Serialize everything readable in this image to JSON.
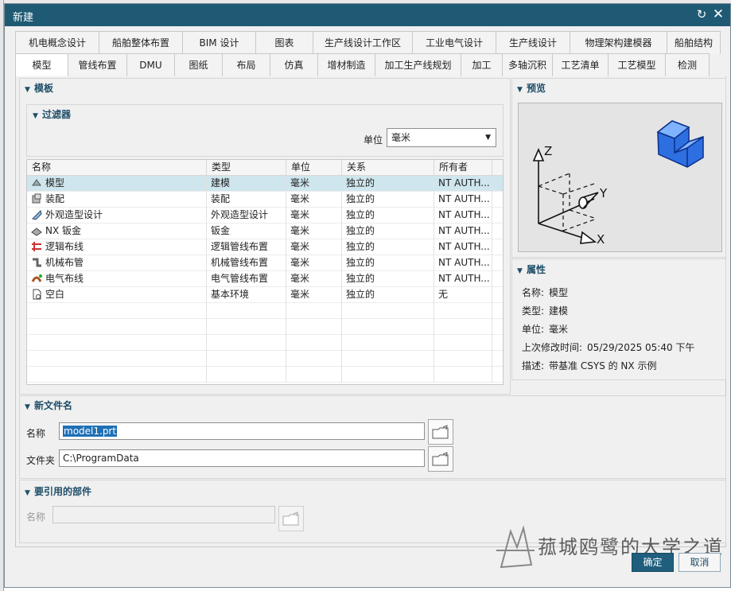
{
  "dialog": {
    "title": "新建",
    "reset_icon": "refresh-icon",
    "close_icon": "close-icon"
  },
  "tabs_row1": [
    "机电概念设计",
    "船舶整体布置",
    "BIM 设计",
    "图表",
    "生产线设计工作区",
    "工业电气设计",
    "生产线设计",
    "物理架构建模器",
    "船舶结构"
  ],
  "tabs_row2": [
    "模型",
    "管线布置",
    "DMU",
    "图纸",
    "布局",
    "仿真",
    "增材制造",
    "加工生产线规划",
    "加工",
    "多轴沉积",
    "工艺清单",
    "工艺模型",
    "检测"
  ],
  "active_tab": "模型",
  "templates": {
    "header": "模板",
    "filter": {
      "header": "过滤器",
      "unit_label": "单位",
      "unit_value": "毫米"
    },
    "columns": [
      "名称",
      "类型",
      "单位",
      "关系",
      "所有者"
    ],
    "rows": [
      {
        "name": "模型",
        "type": "建模",
        "unit": "毫米",
        "relation": "独立的",
        "owner": "NT AUTH...",
        "icon": "model-icon"
      },
      {
        "name": "装配",
        "type": "装配",
        "unit": "毫米",
        "relation": "独立的",
        "owner": "NT AUTH...",
        "icon": "assembly-icon"
      },
      {
        "name": "外观造型设计",
        "type": "外观造型设计",
        "unit": "毫米",
        "relation": "独立的",
        "owner": "NT AUTH...",
        "icon": "shape-studio-icon"
      },
      {
        "name": "NX 钣金",
        "type": "钣金",
        "unit": "毫米",
        "relation": "独立的",
        "owner": "NT AUTH...",
        "icon": "sheet-metal-icon"
      },
      {
        "name": "逻辑布线",
        "type": "逻辑管线布置",
        "unit": "毫米",
        "relation": "独立的",
        "owner": "NT AUTH...",
        "icon": "logical-routing-icon"
      },
      {
        "name": "机械布管",
        "type": "机械管线布置",
        "unit": "毫米",
        "relation": "独立的",
        "owner": "NT AUTH...",
        "icon": "mechanical-routing-icon"
      },
      {
        "name": "电气布线",
        "type": "电气管线布置",
        "unit": "毫米",
        "relation": "独立的",
        "owner": "NT AUTH...",
        "icon": "electrical-routing-icon"
      },
      {
        "name": "空白",
        "type": "基本环境",
        "unit": "毫米",
        "relation": "独立的",
        "owner": "无",
        "icon": "blank-file-icon"
      }
    ],
    "selected_row": 0
  },
  "preview": {
    "header": "预览",
    "axis_labels": {
      "z": "Z",
      "y": "Y",
      "x": "X"
    }
  },
  "properties": {
    "header": "属性",
    "rows": [
      {
        "label": "名称:",
        "value": "模型"
      },
      {
        "label": "类型:",
        "value": "建模"
      },
      {
        "label": "单位:",
        "value": "毫米"
      },
      {
        "label": "上次修改时间:",
        "value": "05/29/2025 05:40 下午"
      },
      {
        "label": "描述:",
        "value": "带基准 CSYS 的 NX 示例"
      }
    ]
  },
  "new_file": {
    "header": "新文件名",
    "name_label": "名称",
    "name_value": "model1.prt",
    "folder_label": "文件夹",
    "folder_value": "C:\\ProgramData"
  },
  "referenced_part": {
    "header": "要引用的部件",
    "name_label": "名称",
    "name_value": ""
  },
  "buttons": {
    "ok": "确定",
    "cancel": "取消"
  },
  "watermark": {
    "text": "菰城鸥鹭的大学之道"
  }
}
